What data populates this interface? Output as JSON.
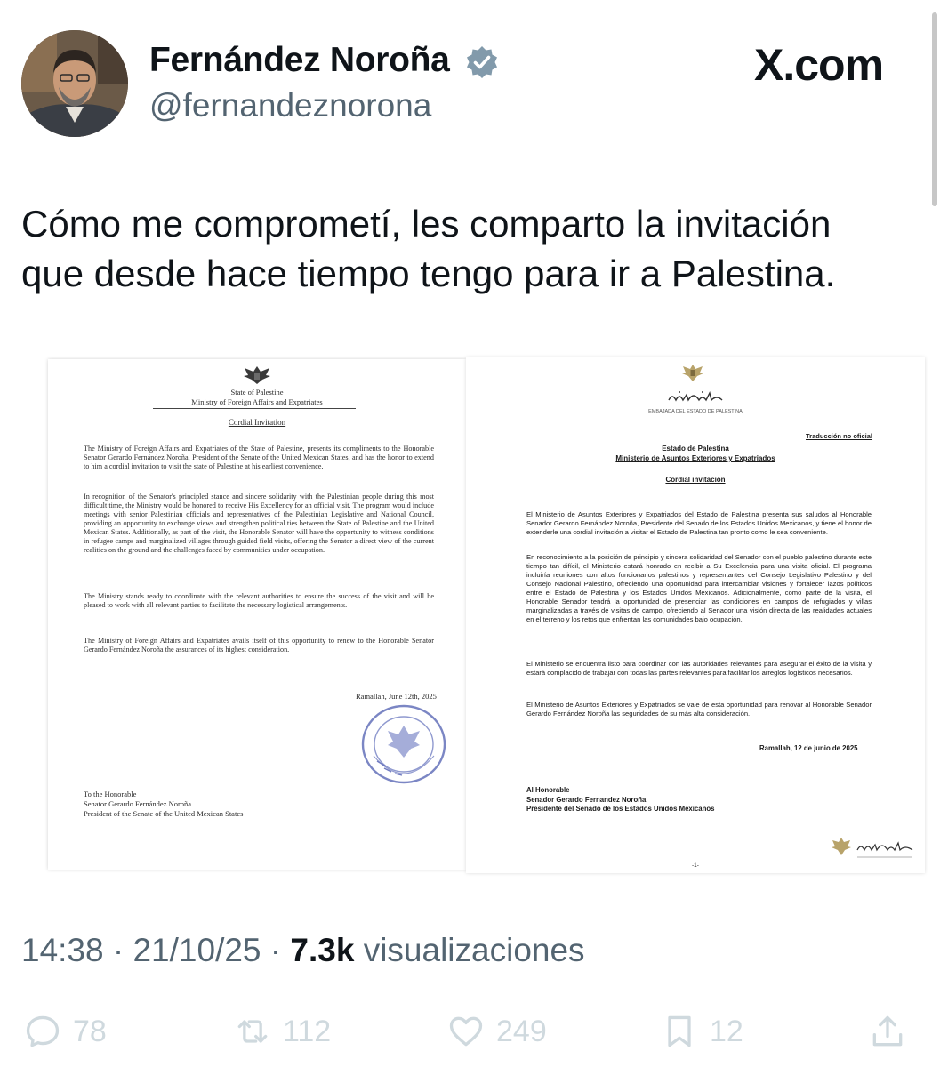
{
  "tweet": {
    "author_name": "Fernández Noroña",
    "author_handle": "@fernandeznorona",
    "source_brand": "X.com",
    "text_lines": [
      "Cómo me comprometí, les comparto la invitación",
      "que desde hace tiempo tengo para ir a Palestina."
    ],
    "time": "14:38",
    "date": "21/10/25",
    "views_count": "7.3k",
    "views_label": "visualizaciones",
    "replies": "78",
    "reposts": "112",
    "likes": "249",
    "bookmarks": "12"
  },
  "doc_en": {
    "header_state": "State of Palestine",
    "header_ministry": "Ministry of Foreign Affairs and Expatriates",
    "title": "Cordial Invitation",
    "paragraphs": [
      "The Ministry of Foreign Affairs and Expatriates of the State of Palestine, presents its compliments to the Honorable Senator Gerardo Fernández Noroña, President of the Senate of the United Mexican States, and has the honor to extend to him a cordial invitation to visit the state of Palestine at his earliest convenience.",
      "In recognition of the Senator's principled stance and sincere solidarity with the Palestinian people during this most difficult time, the Ministry would be honored to receive His Excellency for an official visit. The program would include meetings with senior Palestinian officials and representatives of the Palestinian Legislative and National Council, providing an opportunity to exchange views and strengthen political ties between the State of Palestine and the United Mexican States. Additionally, as part of the visit, the Honorable Senator will have the opportunity to witness conditions in refugee camps and marginalized villages through guided field visits, offering the Senator a direct view of the current realities on the ground and the challenges faced by communities under occupation.",
      "The Ministry stands ready to coordinate with the relevant authorities to ensure the success of the visit and will be pleased to work with all relevant parties to facilitate the necessary logistical arrangements.",
      "The Ministry of Foreign Affairs and Expatriates avails itself of this opportunity to renew to the Honorable Senator Gerardo Fernández Noroña the assurances of its highest consideration."
    ],
    "date": "Ramallah, June 12th, 2025",
    "recipient_lines": [
      "To the Honorable",
      "Senator Gerardo Fernández Noroña",
      "President of the Senate of the United Mexican States"
    ],
    "seal_text": "State of Palestine"
  },
  "doc_es": {
    "embassy_line": "EMBAJADA DEL ESTADO DE PALESTINA",
    "translation_note": "Traducción no oficial",
    "header_state": "Estado de Palestina",
    "header_ministry": "Ministerio de Asuntos Exteriores y Expatriados",
    "title": "Cordial invitación",
    "paragraphs": [
      "El Ministerio de Asuntos Exteriores y Expatriados del Estado de Palestina presenta sus saludos al Honorable Senador Gerardo Fernández Noroña, Presidente del Senado de los Estados Unidos Mexicanos, y tiene el honor de extenderle una cordial invitación a visitar el Estado de Palestina tan pronto como le sea conveniente.",
      "En reconocimiento a la posición de principio y sincera solidaridad del Senador con el pueblo palestino durante este tiempo tan difícil, el Ministerio estará honrado en recibir a Su Excelencia para una visita oficial. El programa incluiría reuniones con altos funcionarios palestinos y representantes del Consejo Legislativo Palestino y del Consejo Nacional Palestino, ofreciendo una oportunidad para intercambiar visiones y fortalecer lazos políticos entre el Estado de Palestina y los Estados Unidos Mexicanos. Adicionalmente, como parte de la visita, el Honorable Senador tendrá la oportunidad de presenciar las condiciones en campos de refugiados y villas marginalizadas a través de visitas de campo, ofreciendo al Senador una visión directa de las realidades actuales en el terreno y los retos que enfrentan las comunidades bajo ocupación.",
      "El Ministerio se encuentra listo para coordinar con las autoridades relevantes para asegurar el éxito de la visita y estará complacido de trabajar con todas las partes relevantes para facilitar los arreglos logísticos necesarios.",
      "El Ministerio de Asuntos Exteriores y Expatriados se vale de esta oportunidad para renovar al Honorable Senador Gerardo Fernández Noroña las seguridades de su más alta consideración."
    ],
    "date": "Ramallah, 12 de junio de 2025",
    "recipient_lines": [
      "Al Honorable",
      "Senador Gerardo Fernandez Noroña",
      "Presidente del Senado de los Estados Unidos Mexicanos"
    ],
    "page_number": "-1-"
  },
  "colors": {
    "text": "#0f1419",
    "secondary": "#536471",
    "verified": "#829aab",
    "action_icons": "#cfd9de"
  }
}
